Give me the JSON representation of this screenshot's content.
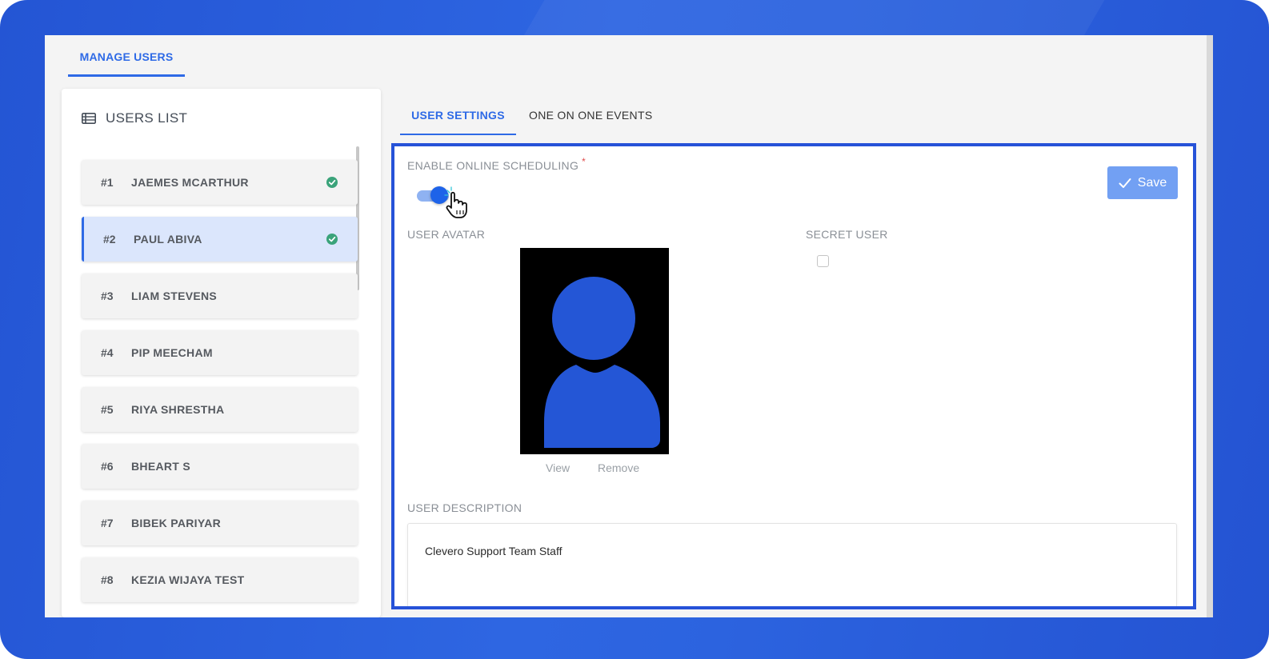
{
  "top_nav": {
    "tab_label": "MANAGE USERS"
  },
  "users_list": {
    "title": "USERS LIST",
    "items": [
      {
        "num": "#1",
        "name": "JAEMES MCARTHUR",
        "verified": true,
        "active": false
      },
      {
        "num": "#2",
        "name": "PAUL ABIVA",
        "verified": true,
        "active": true
      },
      {
        "num": "#3",
        "name": "LIAM STEVENS",
        "verified": false,
        "active": false
      },
      {
        "num": "#4",
        "name": "PIP MEECHAM",
        "verified": false,
        "active": false
      },
      {
        "num": "#5",
        "name": "RIYA SHRESTHA",
        "verified": false,
        "active": false
      },
      {
        "num": "#6",
        "name": "BHEART S",
        "verified": false,
        "active": false
      },
      {
        "num": "#7",
        "name": "BIBEK PARIYAR",
        "verified": false,
        "active": false
      },
      {
        "num": "#8",
        "name": "KEZIA WIJAYA TEST",
        "verified": false,
        "active": false
      }
    ]
  },
  "detail_tabs": {
    "settings": "USER SETTINGS",
    "events": "ONE ON ONE EVENTS"
  },
  "settings": {
    "enable_scheduling_label": "ENABLE ONLINE SCHEDULING",
    "required_mark": "*",
    "enable_scheduling_on": true,
    "save_label": "Save",
    "avatar_label": "USER AVATAR",
    "view_label": "View",
    "remove_label": "Remove",
    "secret_user_label": "SECRET USER",
    "secret_user_checked": false,
    "description_label": "USER DESCRIPTION",
    "description_value": "Clevero Support Team Staff"
  },
  "colors": {
    "accent": "#2e6ae6",
    "frame_blue": "#2652d8",
    "verified_green": "#3aa37a",
    "save_button": "#72a0f3"
  },
  "icons": {
    "users_list": "table-list-icon",
    "verified": "check-circle-icon",
    "save": "checkmark-icon",
    "cursor": "hand-pointer-icon",
    "avatar": "person-silhouette-icon"
  }
}
